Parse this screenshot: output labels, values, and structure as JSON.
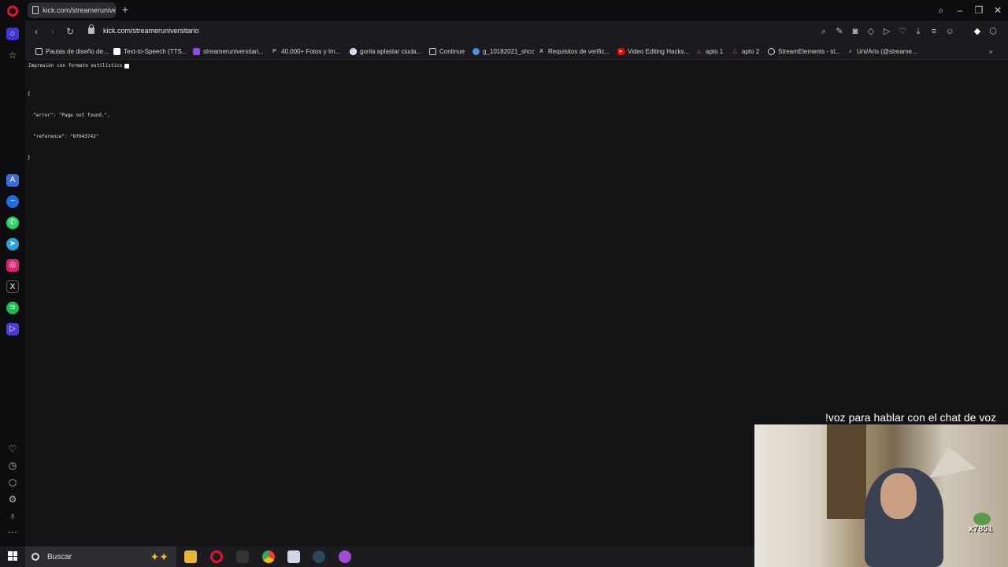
{
  "tab": {
    "title": "kick.com/streameruniversitario"
  },
  "toolbar": {
    "url": "kick.com/streameruniversitario"
  },
  "bookmarks": [
    {
      "label": "Pautas de diseño de...",
      "icon": "document-icon",
      "color": "#cfcfcf"
    },
    {
      "label": "Text-to-Speech (TTS...",
      "icon": "tts-icon",
      "color": "#ffffff"
    },
    {
      "label": "streameruniversitari...",
      "icon": "twitch-icon",
      "color": "#9146ff"
    },
    {
      "label": "40.000+ Fotos y Im...",
      "icon": "pexels-icon",
      "color": "#dddddd"
    },
    {
      "label": "gorila aplastar ciuda...",
      "icon": "google-icon",
      "color": "#ffffff"
    },
    {
      "label": "Continue",
      "icon": "document-icon",
      "color": "#cfcfcf"
    },
    {
      "label": "g_10182021_shcc",
      "icon": "drive-icon",
      "color": "#4a90e2"
    },
    {
      "label": "Requisitos de verific...",
      "icon": "x-icon",
      "color": "#ffffff"
    },
    {
      "label": "Video Editing Hacks...",
      "icon": "youtube-icon",
      "color": "#ff0000"
    },
    {
      "label": "apto 1",
      "icon": "airbnb-icon",
      "color": "#ff5a5f"
    },
    {
      "label": "apto 2",
      "icon": "airbnb-icon",
      "color": "#ff5a5f"
    },
    {
      "label": "StreamElements - st...",
      "icon": "streamelements-icon",
      "color": "#dddddd"
    },
    {
      "label": "Uni/Aris (@streame...",
      "icon": "tiktok-icon",
      "color": "#ffffff"
    }
  ],
  "content": {
    "pretty_print_label": "Impresión con formato estilístico",
    "json_lines": [
      "{",
      "  \"error\": \"Page not found.\",",
      "  \"reference\": \"6f043742\"",
      "}"
    ]
  },
  "overlay": {
    "caption": "!voz para hablar con el chat de voz",
    "badge": "x7851"
  },
  "taskbar": {
    "search_placeholder": "Buscar"
  }
}
